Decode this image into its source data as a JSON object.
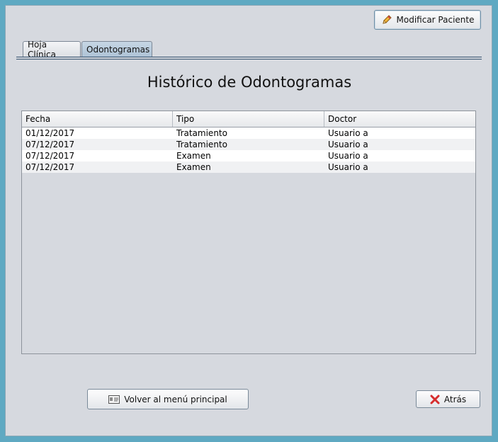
{
  "header": {
    "modify_label": "Modificar Paciente"
  },
  "tabs": [
    {
      "label": "Hoja Clínica",
      "selected": false
    },
    {
      "label": "Odontogramas",
      "selected": true
    }
  ],
  "main": {
    "title": "Histórico de Odontogramas"
  },
  "table": {
    "columns": [
      "Fecha",
      "Tipo",
      "Doctor"
    ],
    "rows": [
      [
        "01/12/2017",
        "Tratamiento",
        "Usuario a"
      ],
      [
        "07/12/2017",
        "Tratamiento",
        "Usuario a"
      ],
      [
        "07/12/2017",
        "Examen",
        "Usuario a"
      ],
      [
        "07/12/2017",
        "Examen",
        "Usuario a"
      ]
    ]
  },
  "footer": {
    "back_menu_label": "Volver al menú principal",
    "back_label": "Atrás"
  },
  "icons": {
    "modify": "pencil-icon",
    "menu": "id-card-icon",
    "back": "red-x-icon"
  },
  "colors": {
    "accent": "#33506d",
    "selected_tab": "#aec3d6",
    "close_red": "#d62d2d"
  }
}
